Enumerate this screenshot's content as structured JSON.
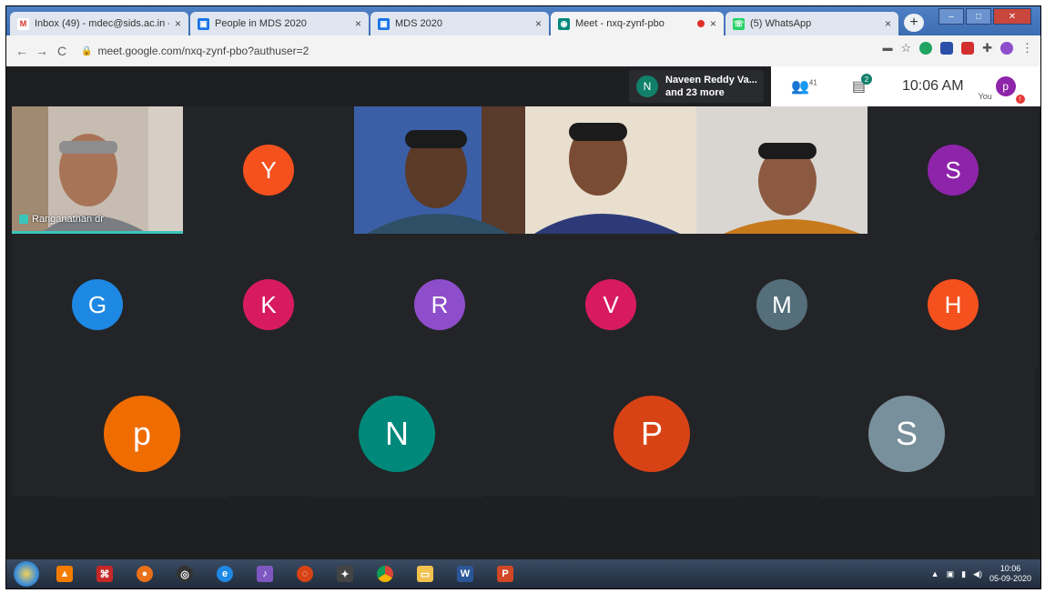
{
  "tabs": [
    {
      "title": "Inbox (49) - mdec@sids.ac.in -",
      "icon": "gmail-icon",
      "color": "#d93025",
      "glyph": "M"
    },
    {
      "title": "People in MDS 2020",
      "icon": "classroom-icon",
      "color": "#1a73e8",
      "glyph": "▣"
    },
    {
      "title": "MDS 2020",
      "icon": "classroom-icon",
      "color": "#1a73e8",
      "glyph": "▣"
    },
    {
      "title": "Meet - nxq-zynf-pbo",
      "icon": "meet-icon",
      "color": "#00897b",
      "glyph": "◉"
    },
    {
      "title": "(5) WhatsApp",
      "icon": "whatsapp-icon",
      "color": "#25d366",
      "glyph": "☏"
    }
  ],
  "close_glyph": "×",
  "new_tab_glyph": "+",
  "toolbar": {
    "back": "←",
    "forward": "→",
    "reload": "C",
    "lock": "🔒",
    "url": "meet.google.com/nxq-zynf-pbo?authuser=2"
  },
  "meet_header": {
    "chip_initial": "N",
    "chip_line1": "Naveen Reddy Va...",
    "chip_line2": "and 23 more",
    "people_count": "41",
    "chat_badge": "2",
    "clock": "10:06 AM",
    "you_label": "You",
    "me_initial": "p"
  },
  "tiles_row1": [
    {
      "type": "video",
      "name": "Ranganathan dr"
    },
    {
      "type": "avatar",
      "initial": "Y",
      "color": "#f4511e"
    },
    {
      "type": "video",
      "name": ""
    },
    {
      "type": "video",
      "name": ""
    },
    {
      "type": "video",
      "name": ""
    },
    {
      "type": "avatar",
      "initial": "S",
      "color": "#8e24aa"
    }
  ],
  "tiles_row2": [
    {
      "initial": "G",
      "color": "#1e88e5"
    },
    {
      "initial": "K",
      "color": "#d81b60"
    },
    {
      "initial": "R",
      "color": "#8e4ecb"
    },
    {
      "initial": "V",
      "color": "#d81b60"
    },
    {
      "initial": "M",
      "color": "#546e7a"
    },
    {
      "initial": "H",
      "color": "#f4511e"
    }
  ],
  "tiles_row3": [
    {
      "initial": "p",
      "color": "#ef6c00"
    },
    {
      "initial": "N",
      "color": "#00897b"
    },
    {
      "initial": "P",
      "color": "#d84315"
    },
    {
      "initial": "S",
      "color": "#78909c"
    }
  ],
  "taskbar": {
    "time": "10:06",
    "date": "05-09-2020"
  }
}
